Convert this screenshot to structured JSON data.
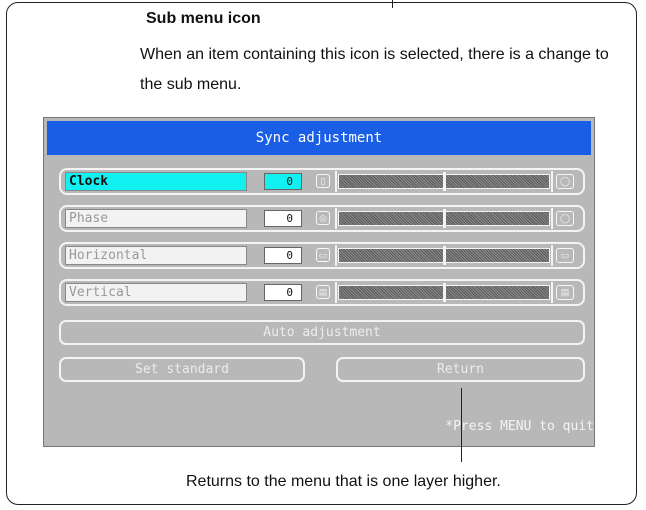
{
  "note": {
    "title": "Sub menu icon",
    "body": "When an item containing this icon is selected, there is a change to the sub menu.",
    "return_note": "Returns to the menu that is one layer higher."
  },
  "osd": {
    "title": "Sync adjustment",
    "rows": [
      {
        "label": "Clock",
        "value": "0",
        "icon_left": "clock-icon",
        "icon_right": "circle-icon",
        "level": 0.5,
        "active": true
      },
      {
        "label": "Phase",
        "value": "0",
        "icon_left": "phase-icon",
        "icon_right": "circle-icon",
        "level": 0.5,
        "active": false
      },
      {
        "label": "Horizontal",
        "value": "0",
        "icon_left": "horizontal-position-icon",
        "icon_right": "horizontal-position-icon",
        "level": 0.5,
        "active": false
      },
      {
        "label": "Vertical",
        "value": "0",
        "icon_left": "vertical-position-icon",
        "icon_right": "vertical-position-icon",
        "level": 0.5,
        "active": false
      }
    ],
    "auto_adjustment": "Auto adjustment",
    "set_standard": "Set standard",
    "return": "Return",
    "hint": "*Press MENU to quit",
    "colors": {
      "title_bar": "#1b5ee6",
      "selected": "#13f0f2",
      "panel": "#b8b8b8"
    }
  }
}
